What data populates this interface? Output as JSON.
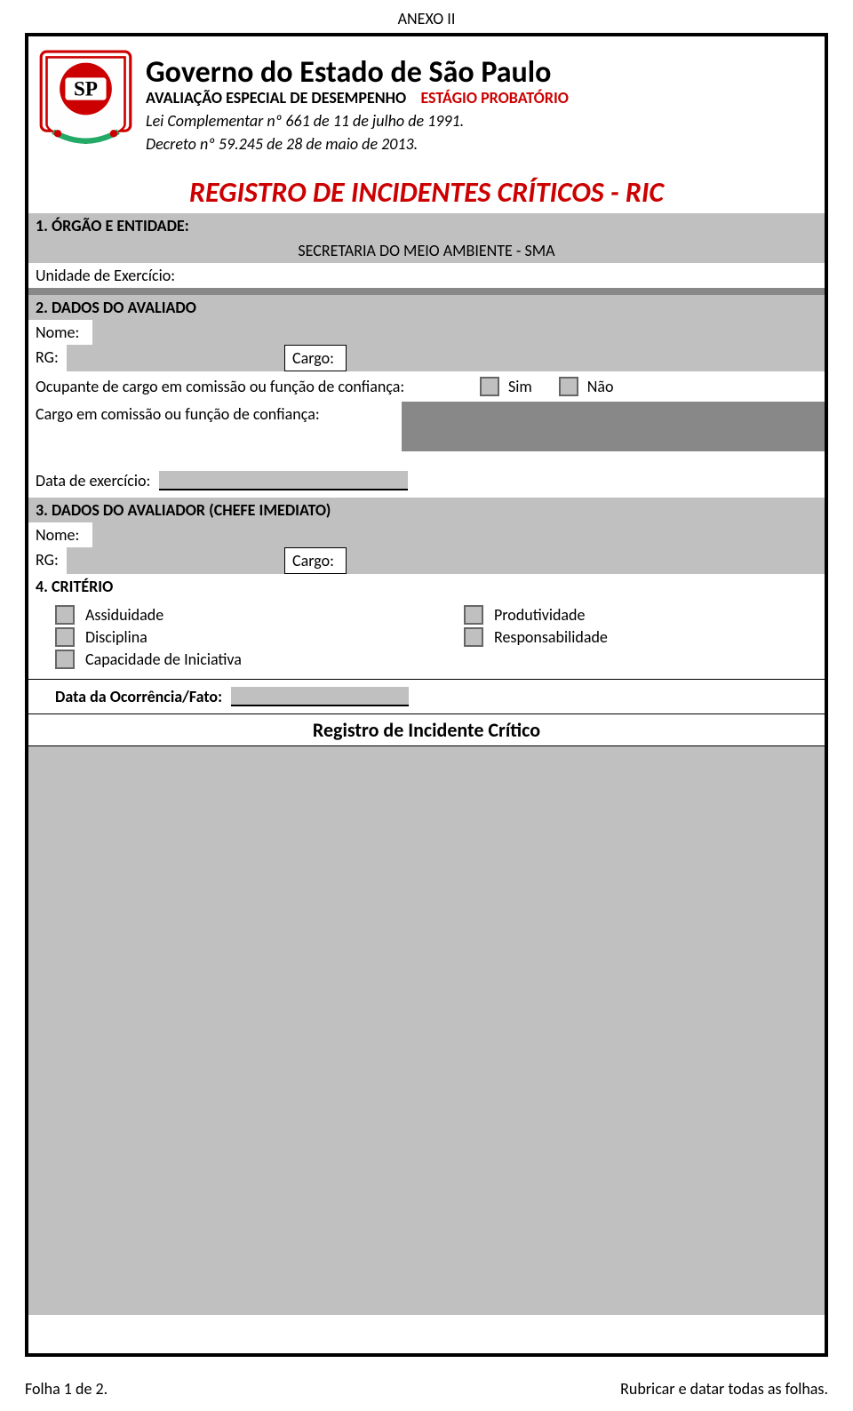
{
  "top": {
    "anexo": "ANEXO II"
  },
  "header": {
    "governo": "Governo do Estado de São Paulo",
    "avaliacao": "AVALIAÇÃO ESPECIAL DE DESEMPENHO",
    "estagio": "ESTÁGIO PROBATÓRIO",
    "lei": "Lei Complementar nº 661 de 11 de julho de 1991.",
    "decreto": "Decreto nº 59.245 de 28 de maio de 2013.",
    "ric_title": "REGISTRO DE INCIDENTES CRÍTICOS - RIC"
  },
  "section1": {
    "heading": "1. ÓRGÃO E ENTIDADE:",
    "secretaria": "SECRETARIA DO MEIO AMBIENTE - SMA",
    "unidade_label": "Unidade de Exercício:",
    "unidade_value": ""
  },
  "section2": {
    "heading": "2. DADOS DO AVALIADO",
    "nome_label": "Nome:",
    "nome_value": "",
    "rg_label": "RG:",
    "rg_value": "",
    "cargo_label": "Cargo:",
    "cargo_value": "",
    "ocupante_label": "Ocupante de cargo em comissão ou função de confiança:",
    "sim": "Sim",
    "nao": "Não",
    "cargo_comissao_label": "Cargo em comissão ou função de confiança:",
    "cargo_comissao_value": "",
    "data_exercicio_label": "Data de exercício:",
    "data_exercicio_value": ""
  },
  "section3": {
    "heading": "3. DADOS DO AVALIADOR (CHEFE IMEDIATO)",
    "nome_label": "Nome:",
    "nome_value": "",
    "rg_label": "RG:",
    "rg_value": "",
    "cargo_label": "Cargo:",
    "cargo_value": ""
  },
  "section4": {
    "heading": "4. CRITÉRIO",
    "criteria": {
      "assiduidade": "Assiduidade",
      "produtividade": "Produtividade",
      "disciplina": "Disciplina",
      "responsabilidade": "Responsabilidade",
      "capacidade": "Capacidade de Iniciativa"
    },
    "data_ocorrencia_label": "Data da Ocorrência/Fato:",
    "data_ocorrencia_value": "",
    "registro_heading": "Registro de Incidente Crítico",
    "registro_value": ""
  },
  "footer": {
    "folha": "Folha 1 de 2.",
    "rubricar": "Rubricar e datar todas as folhas."
  }
}
